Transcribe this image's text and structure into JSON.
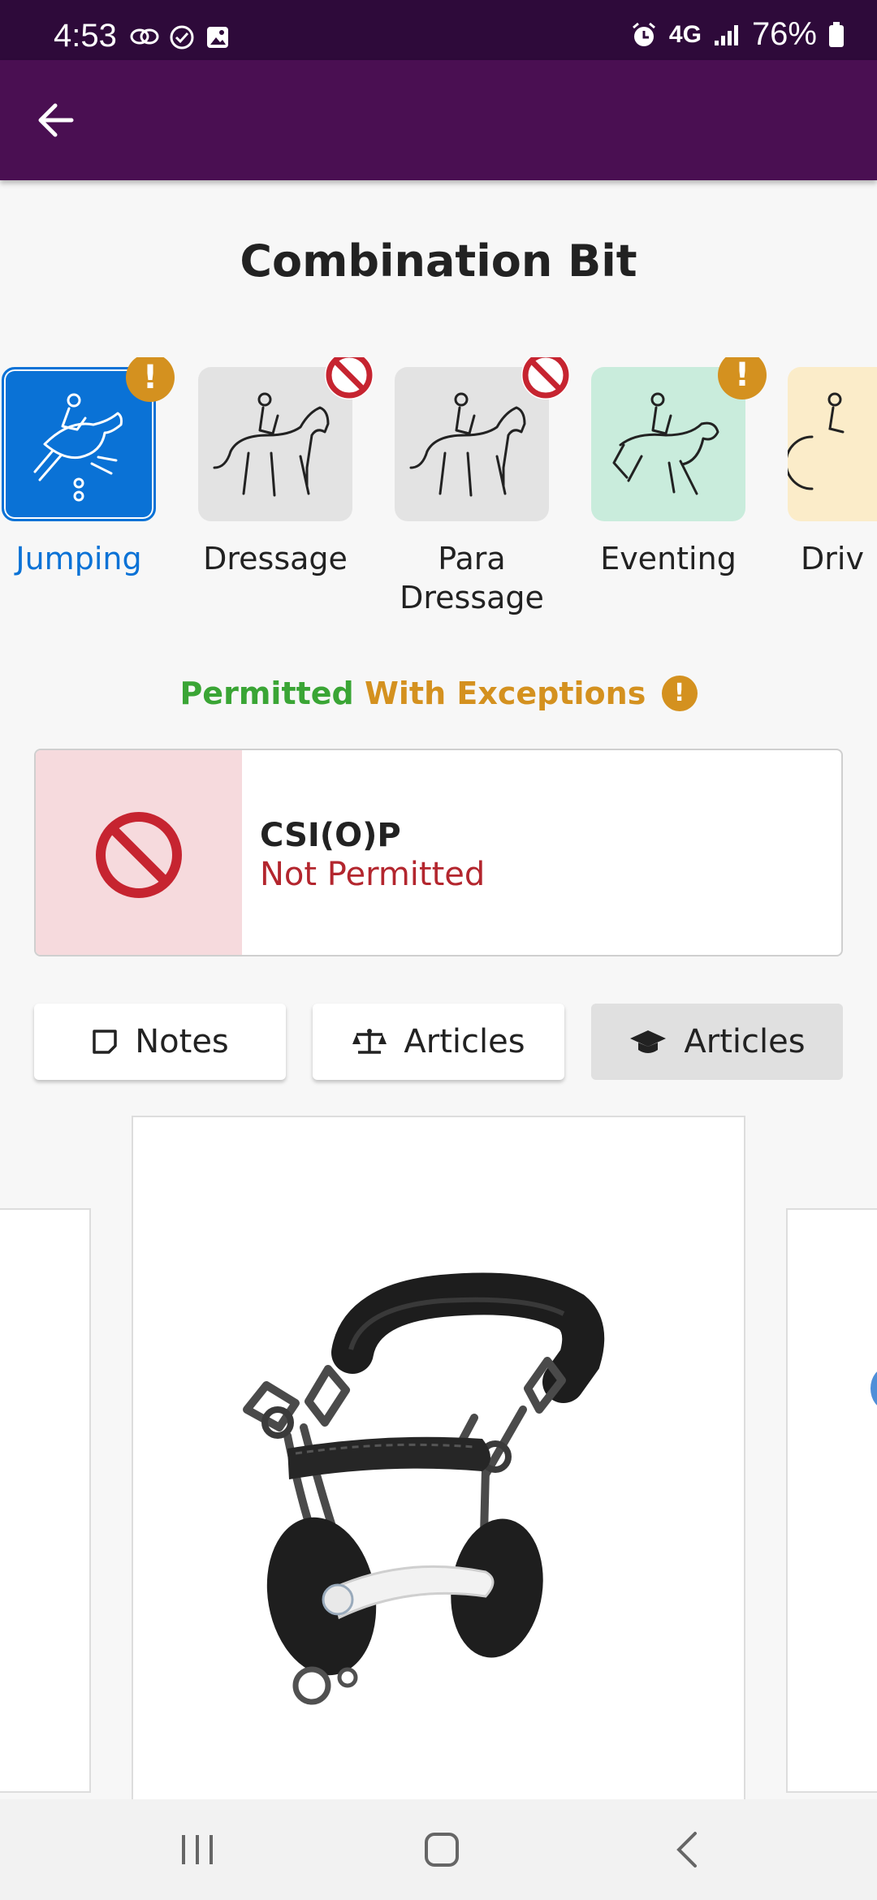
{
  "status_bar": {
    "time": "4:53",
    "network": "4G",
    "battery": "76%"
  },
  "page": {
    "title": "Combination Bit"
  },
  "disciplines": [
    {
      "label": "Jumping",
      "status": "warning",
      "selected": true,
      "icon": "jumping-horse-icon",
      "color": "#0a72d6"
    },
    {
      "label": "Dressage",
      "status": "not-permitted",
      "selected": false,
      "icon": "dressage-horse-icon",
      "color": "#e3e3e3"
    },
    {
      "label": "Para Dressage",
      "status": "not-permitted",
      "selected": false,
      "icon": "para-dressage-horse-icon",
      "color": "#e3e3e3"
    },
    {
      "label": "Eventing",
      "status": "warning",
      "selected": false,
      "icon": "eventing-horse-icon",
      "color": "#c9ecdc"
    },
    {
      "label": "Driv",
      "status": "none",
      "selected": false,
      "icon": "driving-horse-icon",
      "color": "#fbecc9"
    }
  ],
  "status": {
    "permitted": "Permitted",
    "exceptions": "With Exceptions",
    "warn": "!"
  },
  "rule": {
    "name": "CSI(O)P",
    "status": "Not Permitted"
  },
  "actions": {
    "notes": "Notes",
    "rules_articles": "Articles",
    "edu_articles": "Articles"
  },
  "colors": {
    "accent": "#4a0f52",
    "permitted": "#3aa535",
    "warning": "#d4911f",
    "not_permitted": "#b3262e",
    "selected": "#0a72d6"
  },
  "image": {
    "subject": "combination-bit-photo"
  }
}
